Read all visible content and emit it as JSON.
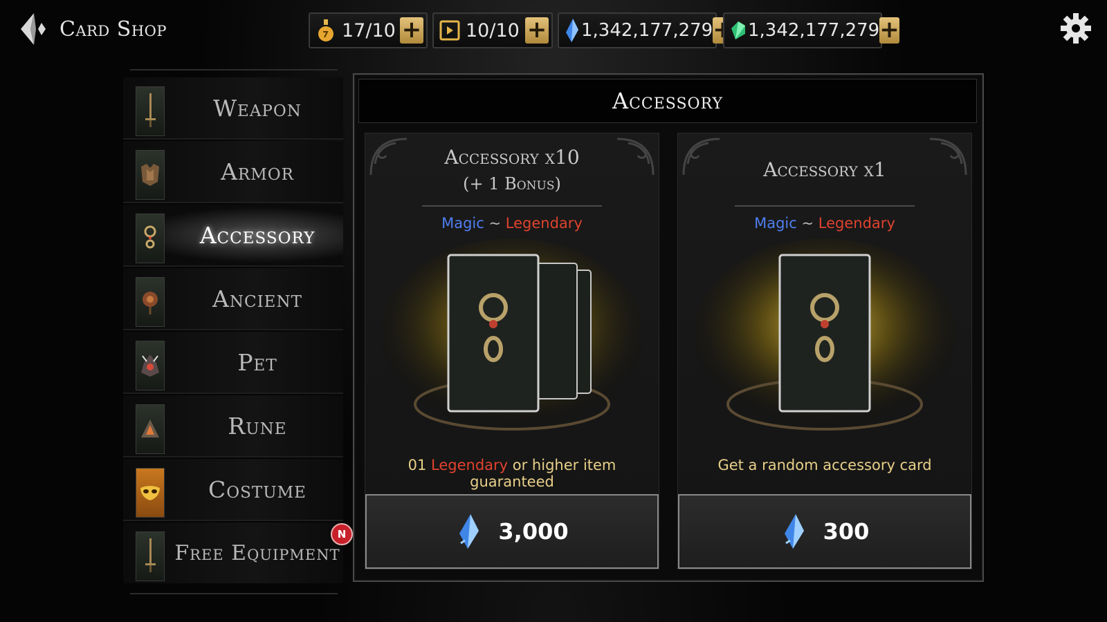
{
  "header": {
    "title": "Card Shop",
    "resources": [
      {
        "icon": "stamina-flask-icon",
        "value": "17/10"
      },
      {
        "icon": "ticket-icon",
        "value": "10/10"
      },
      {
        "icon": "blue-crystal-icon",
        "value": "1,342,177,279"
      },
      {
        "icon": "green-gem-icon",
        "value": "1,342,177,279"
      }
    ]
  },
  "sidebar": {
    "items": [
      {
        "label": "Weapon"
      },
      {
        "label": "Armor"
      },
      {
        "label": "Accessory",
        "active": true
      },
      {
        "label": "Ancient"
      },
      {
        "label": "Pet"
      },
      {
        "label": "Rune"
      },
      {
        "label": "Costume"
      },
      {
        "label": "Free Equipment"
      }
    ],
    "new_badge": "N"
  },
  "panel": {
    "title": "Accessory",
    "offers": [
      {
        "title": "Accessory x10",
        "subtitle": "(+ 1 Bonus)",
        "rarity_from": "Magic",
        "rarity_sep": "~",
        "rarity_to": "Legendary",
        "desc_prefix": "01 ",
        "desc_highlight": "Legendary",
        "desc_suffix": " or higher item guaranteed",
        "price": "3,000"
      },
      {
        "title": "Accessory x1",
        "rarity_from": "Magic",
        "rarity_sep": "~",
        "rarity_to": "Legendary",
        "desc": "Get a random accessory card",
        "price": "300"
      }
    ]
  },
  "colors": {
    "magic": "#4f7ef0",
    "legendary": "#e0432e",
    "gold": "#e4c27a"
  }
}
